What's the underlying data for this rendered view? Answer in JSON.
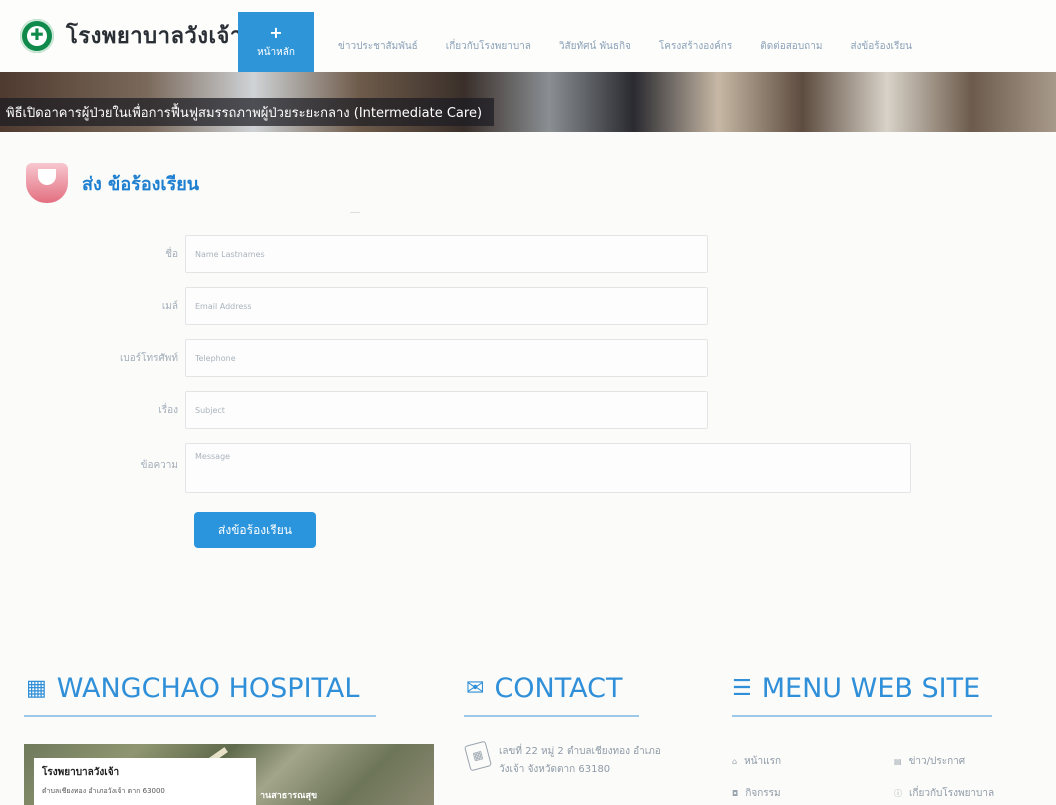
{
  "header": {
    "logo_text": "โรงพยาบาลวังเจ้า",
    "nav": [
      {
        "label": "หน้าหลัก",
        "icon": "plus-icon"
      },
      {
        "label": "ข่าวประชาสัมพันธ์"
      },
      {
        "label": "เกี่ยวกับโรงพยาบาล"
      },
      {
        "label": "วิสัยทัศน์ พันธกิจ"
      },
      {
        "label": "โครงสร้างองค์กร"
      },
      {
        "label": "ติดต่อสอบถาม"
      },
      {
        "label": "ส่งข้อร้องเรียน"
      }
    ]
  },
  "banner": {
    "caption": "พิธีเปิดอาคารผู้ป่วยในเพื่อการฟื้นฟูสมรรถภาพผู้ป่วยระยะกลาง (Intermediate Care)"
  },
  "page": {
    "title": "ส่ง ข้อร้องเรียน"
  },
  "form": {
    "name": {
      "label": "ชื่อ",
      "placeholder": "Name Lastnames"
    },
    "email": {
      "label": "เมล์",
      "placeholder": "Email Address"
    },
    "phone": {
      "label": "เบอร์โทรศัพท์",
      "placeholder": "Telephone"
    },
    "subject": {
      "label": "เรื่อง",
      "placeholder": "Subject"
    },
    "message": {
      "label": "ข้อความ",
      "placeholder": "Message"
    },
    "submit_label": "ส่งข้อร้องเรียน"
  },
  "footer": {
    "hospital": {
      "heading": "WANGCHAO HOSPITAL",
      "icon": "hospital-icon",
      "map_title": "โรงพยาบาลวังเจ้า",
      "map_address": "ตำบลเชียงทอง อำเภอวังเจ้า ตาก 63000",
      "map_label": "านสาธารณสุข"
    },
    "contact": {
      "heading": "CONTACT",
      "icon": "envelope-icon",
      "address_line1": "เลขที่ 22 หมู่ 2 ตำบลเชียงทอง อำเภอ",
      "address_line2": "วังเจ้า จังหวัดตาก 63180"
    },
    "menu": {
      "heading": "MENU WEB SITE",
      "icon": "list-icon",
      "links": [
        {
          "label": "หน้าแรก",
          "icon": "home-icon"
        },
        {
          "label": "ข่าว/ประกาศ",
          "icon": "newspaper-icon"
        },
        {
          "label": "กิจกรรม",
          "icon": "camera-icon"
        },
        {
          "label": "เกี่ยวกับโรงพยาบาล",
          "icon": "info-icon"
        }
      ]
    }
  },
  "colors": {
    "accent": "#2d95d8",
    "title_blue": "#1f7fd0",
    "footer_heading": "#2f8fd8"
  }
}
